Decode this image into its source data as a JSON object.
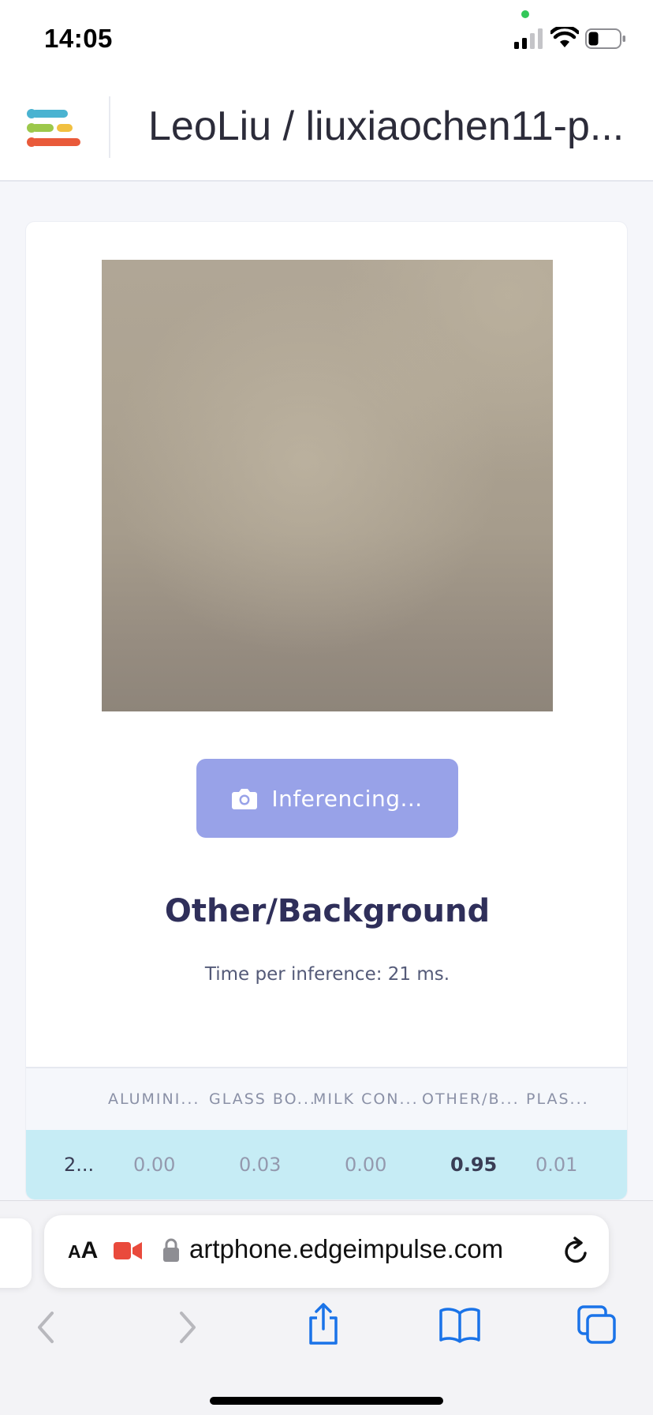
{
  "status_bar": {
    "time": "14:05",
    "icons": [
      "camera-in-use-dot",
      "cellular-signal-icon",
      "wifi-icon",
      "battery-icon"
    ]
  },
  "header": {
    "logo": "edge-impulse-logo",
    "title": "LeoLiu / liuxiaochen11-p..."
  },
  "classifier": {
    "preview_image": "camera-feed",
    "button_label": "Inferencing...",
    "button_icon": "camera-icon",
    "result_label": "Other/Background",
    "timing_text": "Time per inference: 21 ms.",
    "table": {
      "columns": [
        "ALUMINI...",
        "GLASS BO...",
        "MILK CON...",
        "OTHER/B...",
        "PLAS..."
      ],
      "rows": [
        {
          "key": "2...",
          "values": [
            "0.00",
            "0.03",
            "0.00",
            "0.95",
            "0.01"
          ]
        }
      ]
    }
  },
  "browser": {
    "aa_label": "AA",
    "url": "artphone.edgeimpulse.com",
    "icons": [
      "record-icon",
      "lock-icon",
      "reload-icon",
      "back-icon",
      "forward-icon",
      "share-icon",
      "bookmarks-icon",
      "tabs-icon"
    ]
  },
  "colors": {
    "accent_button": "#98a2e8",
    "row_highlight": "#c6ecf5",
    "logo_blue": "#4ab3d1",
    "logo_green": "#9cc84b",
    "logo_yellow": "#f1c040",
    "logo_red": "#e95a3a",
    "ios_blue": "#1a73e8"
  }
}
